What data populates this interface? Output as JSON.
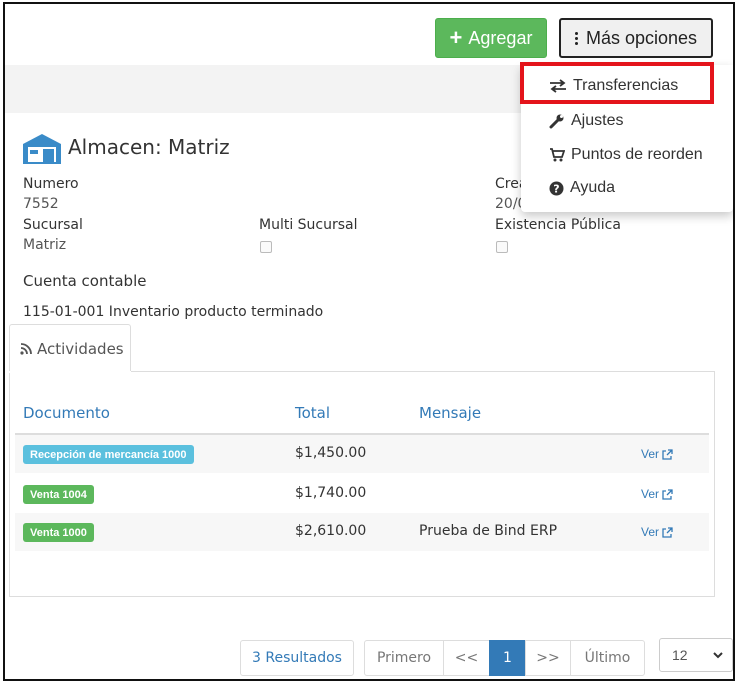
{
  "toolbar": {
    "add_label": "Agregar",
    "more_label": "Más opciones"
  },
  "menu": {
    "items": [
      {
        "label": "Transferencias",
        "icon": "exchange-icon"
      },
      {
        "label": "Ajustes",
        "icon": "wrench-icon"
      },
      {
        "label": "Puntos de reorden",
        "icon": "cart-icon"
      },
      {
        "label": "Ayuda",
        "icon": "question-circle-icon"
      }
    ],
    "highlight_color": "#e4141b"
  },
  "warehouse": {
    "title": "Almacen: Matriz",
    "fields": {
      "numero_label": "Numero",
      "numero_value": "7552",
      "creado_label": "Crea",
      "creado_value": "20/0",
      "sucursal_label": "Sucursal",
      "sucursal_value": "Matriz",
      "multi_label": "Multi Sucursal",
      "existencia_label": "Existencia Pública",
      "cuenta_label": "Cuenta contable",
      "cuenta_value": "115-01-001 Inventario producto terminado"
    }
  },
  "tabs": {
    "actividades": "Actividades"
  },
  "table": {
    "headers": [
      "Documento",
      "Total",
      "Mensaje"
    ],
    "rows": [
      {
        "documento": "Recepción de mercancía 1000",
        "badge": "info",
        "total": "$1,450.00",
        "mensaje": "",
        "action": "Ver"
      },
      {
        "documento": "Venta 1004",
        "badge": "success",
        "total": "$1,740.00",
        "mensaje": "",
        "action": "Ver"
      },
      {
        "documento": "Venta 1000",
        "badge": "success",
        "total": "$2,610.00",
        "mensaje": "Prueba de Bind ERP",
        "action": "Ver"
      }
    ]
  },
  "pagination": {
    "results": "3 Resultados",
    "first": "Primero",
    "prev": "<<",
    "current": "1",
    "next": ">>",
    "last": "Último",
    "page_size": "12"
  },
  "colors": {
    "primary": "#337ab7",
    "success": "#5cb85c",
    "info": "#5bc0de"
  }
}
